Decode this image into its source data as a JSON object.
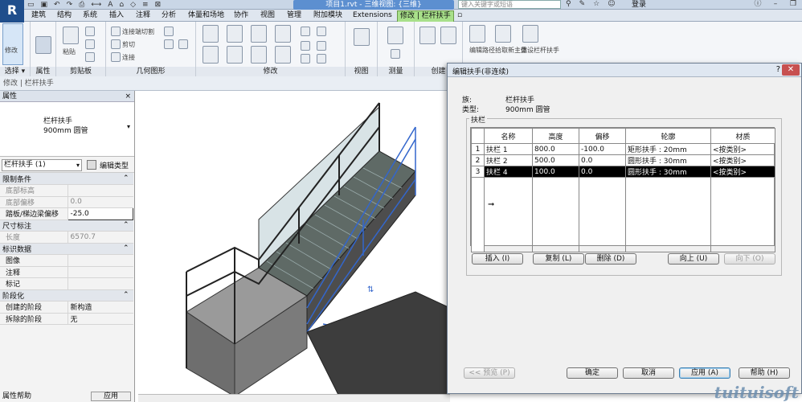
{
  "titlebar": {
    "doc_title": "项目1.rvt - 三维视图: {三维}",
    "search_placeholder": "键入关键字或短语",
    "login": "登录"
  },
  "tabs": [
    "建筑",
    "结构",
    "系统",
    "插入",
    "注释",
    "分析",
    "体量和场地",
    "协作",
    "视图",
    "管理",
    "附加模块",
    "Extensions",
    "修改 | 栏杆扶手"
  ],
  "ribbon": {
    "groups": [
      "选择",
      "属性",
      "剪贴板",
      "几何图形",
      "修改",
      "视图",
      "测量",
      "创建"
    ],
    "small_labels": {
      "connect": "连接端切割",
      "cut": "剪切",
      "join": "连接",
      "modify": "修改",
      "paste": "粘贴",
      "select": "选择 ▾"
    },
    "right_labels": [
      "编辑路径",
      "拾取新主体",
      "重设栏杆扶手"
    ]
  },
  "optionsbar": {
    "text": "修改 | 栏杆扶手"
  },
  "properties": {
    "header": "属性",
    "close": "×",
    "family": "栏杆扶手",
    "type": "900mm 圆管",
    "instance_selector": "栏杆扶手 (1)",
    "edit_type": "编辑类型",
    "rows": [
      {
        "cat": "限制条件"
      },
      {
        "k": "底部标高",
        "v": "",
        "gray": true
      },
      {
        "k": "底部偏移",
        "v": "0.0",
        "gray": true
      },
      {
        "k": "踏板/梯边梁偏移",
        "v": "-25.0",
        "edit": true
      },
      {
        "cat": "尺寸标注"
      },
      {
        "k": "长度",
        "v": "6570.7",
        "gray": true
      },
      {
        "cat": "标识数据"
      },
      {
        "k": "图像",
        "v": ""
      },
      {
        "k": "注释",
        "v": ""
      },
      {
        "k": "标记",
        "v": ""
      },
      {
        "cat": "阶段化"
      },
      {
        "k": "创建的阶段",
        "v": "新构造"
      },
      {
        "k": "拆除的阶段",
        "v": "无"
      }
    ],
    "footer_link": "属性帮助",
    "apply": "应用"
  },
  "dialog": {
    "title": "编辑扶手(非连续)",
    "help": "?",
    "close": "✕",
    "family_label": "族:",
    "family_value": "栏杆扶手",
    "type_label": "类型:",
    "type_value": "900mm 圆管",
    "group_label": "扶栏",
    "columns": [
      "名称",
      "高度",
      "偏移",
      "轮廓",
      "材质"
    ],
    "rows": [
      {
        "n": "1",
        "name": "扶栏 1",
        "height": "800.0",
        "offset": "-100.0",
        "profile": "矩形扶手 : 20mm",
        "material": "<按类别>"
      },
      {
        "n": "2",
        "name": "扶栏 2",
        "height": "500.0",
        "offset": "0.0",
        "profile": "圆形扶手 : 30mm",
        "material": "<按类别>"
      },
      {
        "n": "3",
        "name": "扶栏 4",
        "height": "100.0",
        "offset": "0.0",
        "profile": "圆形扶手 : 30mm",
        "material": "<按类别>"
      }
    ],
    "buttons": {
      "insert": "插入 (I)",
      "copy": "复制 (L)",
      "delete": "删除 (D)",
      "up": "向上 (U)",
      "down": "向下 (O)",
      "preview": "<< 预览 (P)",
      "ok": "确定",
      "cancel": "取消",
      "apply": "应用 (A)",
      "help": "帮助 (H)"
    }
  },
  "watermark": "tuituisoft"
}
